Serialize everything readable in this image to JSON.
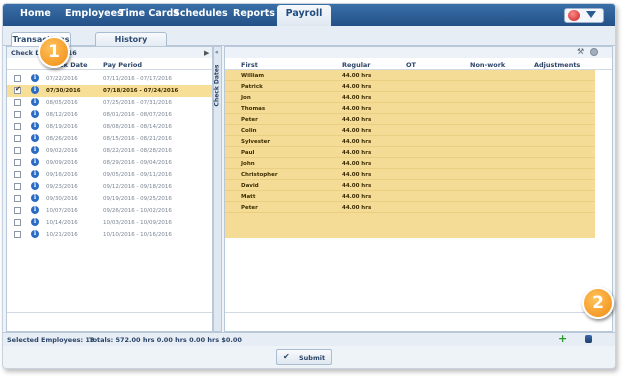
{
  "nav": {
    "items": [
      "Home",
      "Employees",
      "Time Cards",
      "Schedules",
      "Reports"
    ],
    "active": "Payroll"
  },
  "tabs": [
    "Transactions",
    "History"
  ],
  "left": {
    "title": "Check Dates 2016",
    "col_date": "Check Date",
    "col_period": "Pay Period",
    "rows": [
      {
        "date": "07/22/2016",
        "period": "07/11/2016 - 07/17/2016",
        "selected": false
      },
      {
        "date": "07/30/2016",
        "period": "07/18/2016 - 07/24/2016",
        "selected": true
      },
      {
        "date": "08/05/2016",
        "period": "07/25/2016 - 07/31/2016",
        "selected": false
      },
      {
        "date": "08/12/2016",
        "period": "08/01/2016 - 08/07/2016",
        "selected": false
      },
      {
        "date": "08/19/2016",
        "period": "08/08/2016 - 08/14/2016",
        "selected": false
      },
      {
        "date": "08/26/2016",
        "period": "08/15/2016 - 08/21/2016",
        "selected": false
      },
      {
        "date": "09/02/2016",
        "period": "08/22/2016 - 08/28/2016",
        "selected": false
      },
      {
        "date": "09/09/2016",
        "period": "08/29/2016 - 09/04/2016",
        "selected": false
      },
      {
        "date": "09/16/2016",
        "period": "09/05/2016 - 09/11/2016",
        "selected": false
      },
      {
        "date": "09/23/2016",
        "period": "09/12/2016 - 09/18/2016",
        "selected": false
      },
      {
        "date": "09/30/2016",
        "period": "09/19/2016 - 09/25/2016",
        "selected": false
      },
      {
        "date": "10/07/2016",
        "period": "09/26/2016 - 10/02/2016",
        "selected": false
      },
      {
        "date": "10/14/2016",
        "period": "10/03/2016 - 10/09/2016",
        "selected": false
      },
      {
        "date": "10/21/2016",
        "period": "10/10/2016 - 10/16/2016",
        "selected": false
      }
    ]
  },
  "vbar_label": "Check Dates",
  "right": {
    "cols": [
      "First",
      "Regular",
      "OT",
      "Non-work",
      "Adjustments"
    ],
    "rows": [
      {
        "first": "William",
        "regular": "44.00 hrs"
      },
      {
        "first": "Patrick",
        "regular": "44.00 hrs"
      },
      {
        "first": "Jon",
        "regular": "44.00 hrs"
      },
      {
        "first": "Thomas",
        "regular": "44.00 hrs"
      },
      {
        "first": "Peter",
        "regular": "44.00 hrs"
      },
      {
        "first": "Colin",
        "regular": "44.00 hrs"
      },
      {
        "first": "Sylvester",
        "regular": "44.00 hrs"
      },
      {
        "first": "Paul",
        "regular": "44.00 hrs"
      },
      {
        "first": "John",
        "regular": "44.00 hrs"
      },
      {
        "first": "Christopher",
        "regular": "44.00 hrs"
      },
      {
        "first": "David",
        "regular": "44.00 hrs"
      },
      {
        "first": "Matt",
        "regular": "44.00 hrs"
      },
      {
        "first": "Peter",
        "regular": "44.00 hrs"
      }
    ]
  },
  "status": {
    "selected": "Selected Employees: 13",
    "totals": "Totals: 572.00 hrs  0.00 hrs  0.00 hrs  $0.00"
  },
  "submit_label": "Submit",
  "callouts": [
    "1",
    "2"
  ],
  "colors": {
    "nav": "#2a5b95",
    "highlight": "#f4dc96",
    "callout": "#f39a1e"
  }
}
